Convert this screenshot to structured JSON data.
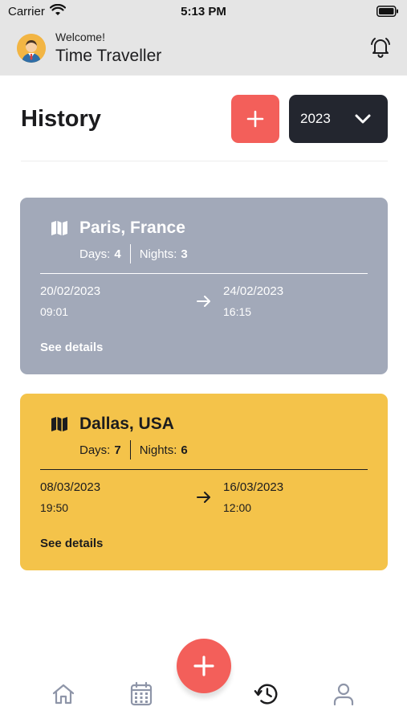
{
  "status_bar": {
    "carrier": "Carrier",
    "time": "5:13 PM"
  },
  "header": {
    "welcome": "Welcome!",
    "username": "Time Traveller"
  },
  "page": {
    "title": "History",
    "year": "2023"
  },
  "trips": [
    {
      "destination": "Paris, France",
      "days_label": "Days:",
      "days": "4",
      "nights_label": "Nights:",
      "nights": "3",
      "start_date": "20/02/2023",
      "start_time": "09:01",
      "end_date": "24/02/2023",
      "end_time": "16:15",
      "details_label": "See details",
      "color": "#a2a9b9"
    },
    {
      "destination": "Dallas, USA",
      "days_label": "Days:",
      "days": "7",
      "nights_label": "Nights:",
      "nights": "6",
      "start_date": "08/03/2023",
      "start_time": "19:50",
      "end_date": "16/03/2023",
      "end_time": "12:00",
      "details_label": "See details",
      "color": "#f4c34a"
    }
  ],
  "tab_bar": {
    "icons": [
      "home-icon",
      "calendar-icon",
      "plus-icon",
      "history-icon",
      "user-icon"
    ],
    "active": "history"
  },
  "colors": {
    "accent": "#f35f5a",
    "dark": "#23262f",
    "inactive_tab": "#8e95a8"
  }
}
